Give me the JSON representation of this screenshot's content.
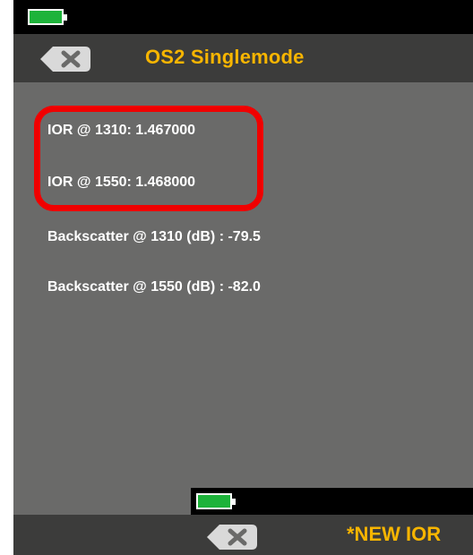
{
  "header": {
    "title": "OS2 Singlemode"
  },
  "ior": [
    {
      "label": "IOR @ 1310: 1.467000"
    },
    {
      "label": "IOR @ 1550: 1.468000"
    }
  ],
  "backscatter": [
    {
      "label": "Backscatter @ 1310 (dB) : -79.5"
    },
    {
      "label": "Backscatter @ 1550 (dB) : -82.0"
    }
  ],
  "footer": {
    "new_ior_label": "*NEW IOR"
  },
  "colors": {
    "accent": "#f7b500",
    "background": "#6a6a69",
    "bar": "#3c3c3b",
    "highlight": "#f00000",
    "battery": "#1db33a"
  },
  "icons": {
    "battery": "battery-icon",
    "back": "back-x-icon"
  }
}
